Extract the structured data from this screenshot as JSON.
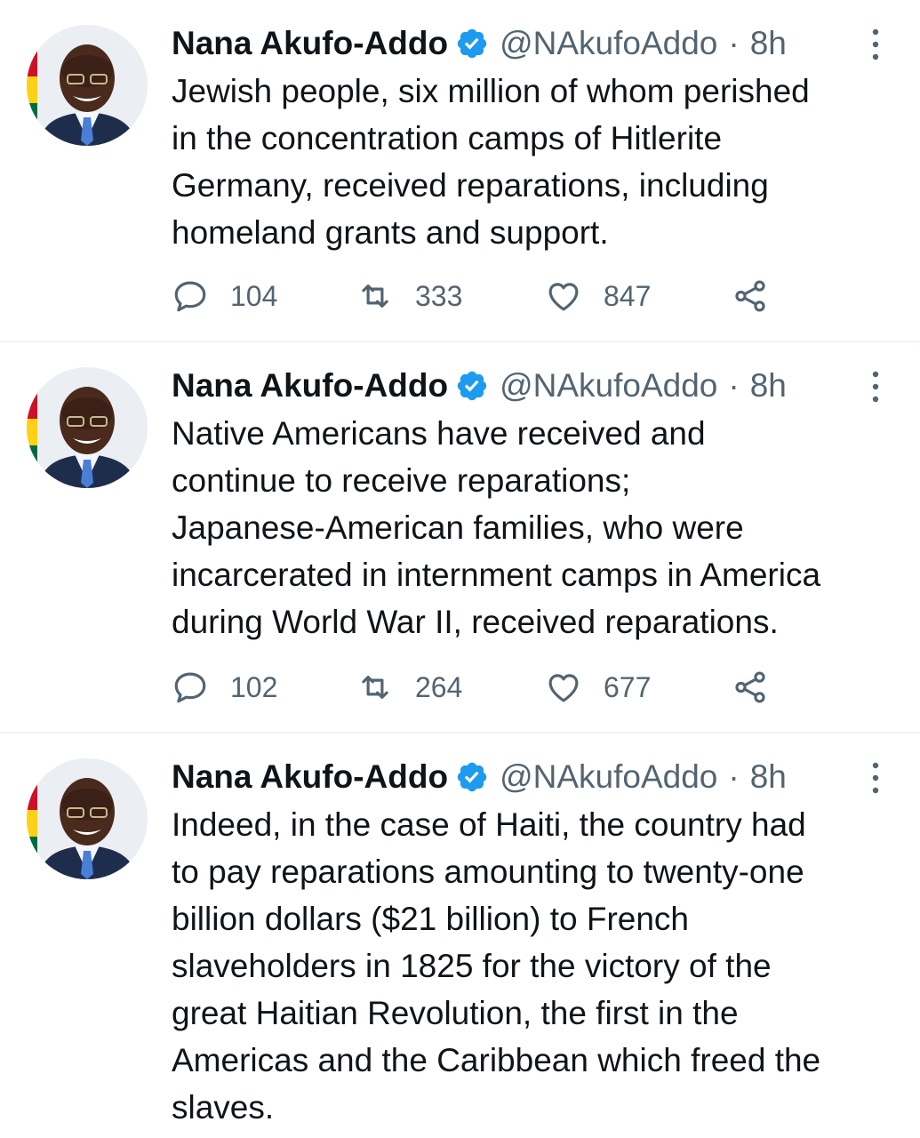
{
  "tweets": [
    {
      "author": "Nana Akufo-Addo",
      "handle": "@NAkufoAddo",
      "separator": "·",
      "time": "8h",
      "text_lines": [
        "Jewish people, six million of whom perished",
        "in the concentration camps of Hitlerite",
        "Germany, received reparations, including",
        "homeland grants and support."
      ],
      "replies": "104",
      "retweets": "333",
      "likes": "847"
    },
    {
      "author": "Nana Akufo-Addo",
      "handle": "@NAkufoAddo",
      "separator": "·",
      "time": "8h",
      "text_lines": [
        "Native Americans have received and",
        "continue to receive reparations;",
        "Japanese-American families, who were",
        "incarcerated in internment camps in America",
        "during World War II, received reparations."
      ],
      "replies": "102",
      "retweets": "264",
      "likes": "677"
    },
    {
      "author": "Nana Akufo-Addo",
      "handle": "@NAkufoAddo",
      "separator": "·",
      "time": "8h",
      "text_lines": [
        "Indeed, in the case of Haiti, the country had",
        "to pay reparations amounting to twenty-one",
        "billion dollars ($21 billion) to French",
        "slaveholders in 1825 for the victory of the",
        "great Haitian Revolution, the first in the",
        "Americas and the Caribbean which freed the",
        "slaves."
      ]
    }
  ],
  "icons": {
    "verified": "verified-badge-icon",
    "more": "more-vertical-icon",
    "reply": "reply-icon",
    "retweet": "retweet-icon",
    "like": "heart-icon",
    "share": "share-icon"
  },
  "colors": {
    "verified_blue": "#1d9bf0",
    "secondary_text": "#536471",
    "divider": "#eff3f4"
  }
}
